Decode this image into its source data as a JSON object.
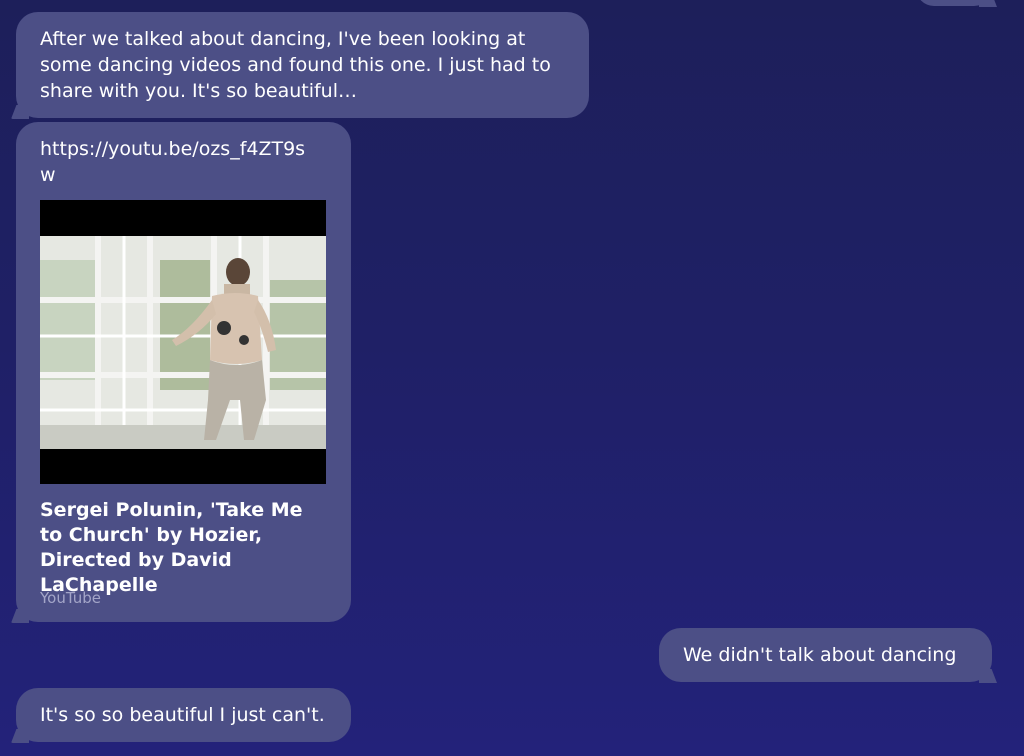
{
  "messages": [
    {
      "text": "After we talked about dancing, I've been looking at\nsome dancing videos and found this one. I just had to\nshare with you. It's so beautiful…"
    },
    {
      "link": "https://youtu.be/ozs_f4ZT9sw",
      "preview": {
        "title": "Sergei Polunin, 'Take Me to Church' by Hozier, Directed by David LaChapelle",
        "source": "YouTube"
      }
    },
    {
      "text": "We didn't talk about dancing"
    },
    {
      "text": "It's so so beautiful I just can't."
    }
  ],
  "colors": {
    "background": "#1f2066",
    "bubble": "#4c4f86",
    "source_text": "#a3a5c8"
  }
}
